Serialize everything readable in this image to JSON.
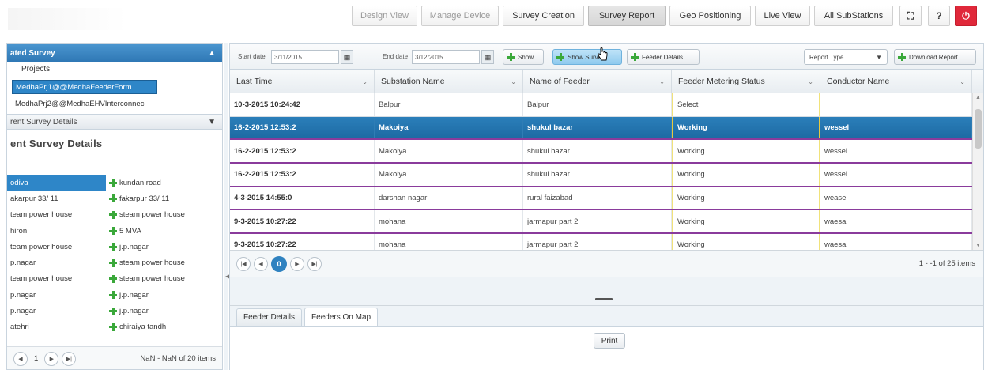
{
  "nav": {
    "buttons": [
      {
        "label": "Design View",
        "state": "disabled"
      },
      {
        "label": "Manage Device",
        "state": "disabled"
      },
      {
        "label": "Survey Creation",
        "state": "normal"
      },
      {
        "label": "Survey Report",
        "state": "active"
      },
      {
        "label": "Geo Positioning",
        "state": "normal"
      },
      {
        "label": "Live View",
        "state": "normal"
      },
      {
        "label": "All SubStations",
        "state": "normal"
      }
    ],
    "fullscreen_icon": "⛶",
    "help_label": "?",
    "power_icon": "⏻"
  },
  "left_panel": {
    "header": "ated Survey",
    "projects_label": "Projects",
    "projects": [
      {
        "label": "MedhaPrj1@@MedhaFeederForm",
        "selected": true
      },
      {
        "label": "MedhaPrj2@@MedhaEHVInterconnec",
        "selected": false
      }
    ],
    "subheader": "rent Survey Details",
    "section_title": "ent Survey Details",
    "rows": [
      {
        "a": "odiva",
        "b": "kundan road",
        "selected": true
      },
      {
        "a": "akarpur 33/ 11",
        "b": "fakarpur 33/ 11",
        "selected": false
      },
      {
        "a": "team power house",
        "b": "steam power house",
        "selected": false
      },
      {
        "a": "hiron",
        "b": "5 MVA",
        "selected": false
      },
      {
        "a": "team power house",
        "b": "j.p.nagar",
        "selected": false
      },
      {
        "a": "p.nagar",
        "b": "steam power house",
        "selected": false
      },
      {
        "a": "team power house",
        "b": "steam power house",
        "selected": false
      },
      {
        "a": "p.nagar",
        "b": "j.p.nagar",
        "selected": false
      },
      {
        "a": "p.nagar",
        "b": "j.p.nagar",
        "selected": false
      },
      {
        "a": "atehri",
        "b": "chiraiya tandh",
        "selected": false
      }
    ],
    "pager": {
      "page": "1",
      "info": "NaN - NaN of 20 items"
    }
  },
  "toolbar": {
    "start_label": "Start date",
    "start_value": "3/11/2015",
    "end_label": "End date",
    "end_value": "3/12/2015",
    "show_label": "Show",
    "show_survey_label": "Show Survey",
    "feeder_details_label": "Feeder Details",
    "report_type_label": "Report Type",
    "download_label": "Download Report"
  },
  "grid": {
    "columns": [
      "Last Time",
      "Substation Name",
      "Name of Feeder",
      "Feeder Metering Status",
      "Conductor Name"
    ],
    "rows": [
      {
        "c": [
          "10-3-2015 10:24:42",
          "Balpur",
          "Balpur",
          "Select",
          ""
        ],
        "selected": false
      },
      {
        "c": [
          "16-2-2015 12:53:2",
          "Makoiya",
          "shukul bazar",
          "Working",
          "wessel"
        ],
        "selected": true
      },
      {
        "c": [
          "16-2-2015 12:53:2",
          "Makoiya",
          "shukul bazar",
          "Working",
          "wessel"
        ],
        "selected": false
      },
      {
        "c": [
          "16-2-2015 12:53:2",
          "Makoiya",
          "shukul bazar",
          "Working",
          "wessel"
        ],
        "selected": false
      },
      {
        "c": [
          "4-3-2015 14:55:0",
          "darshan nagar",
          "rural faizabad",
          "Working",
          "weasel"
        ],
        "selected": false
      },
      {
        "c": [
          "9-3-2015 10:27:22",
          "mohana",
          "jarmapur part 2",
          "Working",
          "waesal"
        ],
        "selected": false
      },
      {
        "c": [
          "9-3-2015 10:27:22",
          "mohana",
          "jarmapur part 2",
          "Working",
          "waesal"
        ],
        "selected": false
      }
    ],
    "pager": {
      "current": "0",
      "info": "1 - -1 of 25 items"
    }
  },
  "bottom": {
    "tabs": [
      {
        "label": "Feeder Details",
        "active": false
      },
      {
        "label": "Feeders On Map",
        "active": true
      }
    ],
    "print_label": "Print"
  },
  "colors": {
    "accent": "#2f82c0",
    "row_separator": "#8a3b9c",
    "power": "#e0283a",
    "add_icon": "#3aa83a"
  }
}
